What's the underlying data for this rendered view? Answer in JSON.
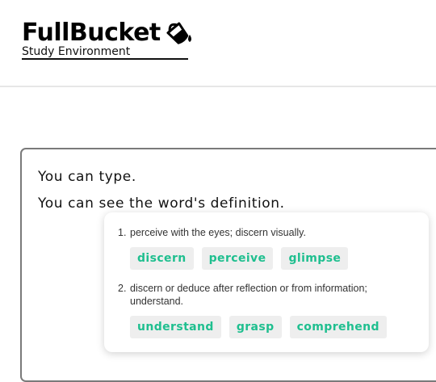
{
  "header": {
    "title": "FullBucket",
    "subtitle": "Study Environment",
    "logo_icon": "paint-bucket-icon"
  },
  "editor": {
    "lines": [
      "You can type.",
      "You can see the word's definition."
    ]
  },
  "definitions": [
    {
      "number": "1.",
      "text": "perceive with the eyes; discern visually.",
      "synonyms": [
        "discern",
        "perceive",
        "glimpse"
      ]
    },
    {
      "number": "2.",
      "text": "discern or deduce after reflection or from information; understand.",
      "synonyms": [
        "understand",
        "grasp",
        "comprehend"
      ]
    }
  ],
  "colors": {
    "accent": "#1fbf8f",
    "chip_bg": "#eeeeee",
    "editor_border": "#7a7a7a"
  }
}
